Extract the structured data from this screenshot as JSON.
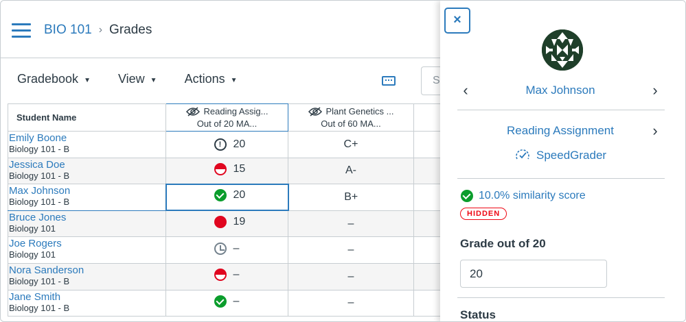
{
  "breadcrumb": {
    "course": "BIO 101",
    "separator": "›",
    "current": "Grades"
  },
  "toolbar": {
    "gradebook": "Gradebook",
    "view": "View",
    "actions": "Actions",
    "caret": "▼",
    "search_placeholder": "Se"
  },
  "grid": {
    "header_student": "Student Name",
    "assignments": [
      {
        "title": "Reading Assig...",
        "subtitle": "Out of 20 MA..."
      },
      {
        "title": "Plant Genetics ...",
        "subtitle": "Out of 60 MA..."
      }
    ],
    "rows": [
      {
        "name": "Emily Boone",
        "section": "Biology 101 - B",
        "icon": "exclamation-icon",
        "grade_a": "20",
        "grade_b": "C+"
      },
      {
        "name": "Jessica Doe",
        "section": "Biology 101 - B",
        "icon": "half-circle-icon",
        "grade_a": "15",
        "grade_b": "A-"
      },
      {
        "name": "Max Johnson",
        "section": "Biology 101 - B",
        "icon": "check-circle-icon",
        "grade_a": "20",
        "grade_b": "B+"
      },
      {
        "name": "Bruce Jones",
        "section": "Biology 101",
        "icon": "full-circle-icon",
        "grade_a": "19",
        "grade_b": "–"
      },
      {
        "name": "Joe Rogers",
        "section": "Biology 101",
        "icon": "clock-icon",
        "grade_a": "–",
        "grade_b": "–"
      },
      {
        "name": "Nora Sanderson",
        "section": "Biology 101 - B",
        "icon": "half-circle-icon",
        "grade_a": "–",
        "grade_b": "–"
      },
      {
        "name": "Jane Smith",
        "section": "Biology 101 - B",
        "icon": "check-circle-icon",
        "grade_a": "–",
        "grade_b": "–"
      }
    ]
  },
  "tray": {
    "close": "×",
    "student_name": "Max Johnson",
    "assignment_name": "Reading Assignment",
    "speedgrader": "SpeedGrader",
    "similarity": "10.0% similarity score",
    "hidden_badge": "HIDDEN",
    "grade_label": "Grade out of 20",
    "grade_value": "20",
    "status_label": "Status",
    "prev": "‹",
    "next": "›"
  },
  "colors": {
    "link": "#2b7abc",
    "success": "#0b9d2c",
    "danger": "#e0061f",
    "badge": "#ee0612"
  }
}
